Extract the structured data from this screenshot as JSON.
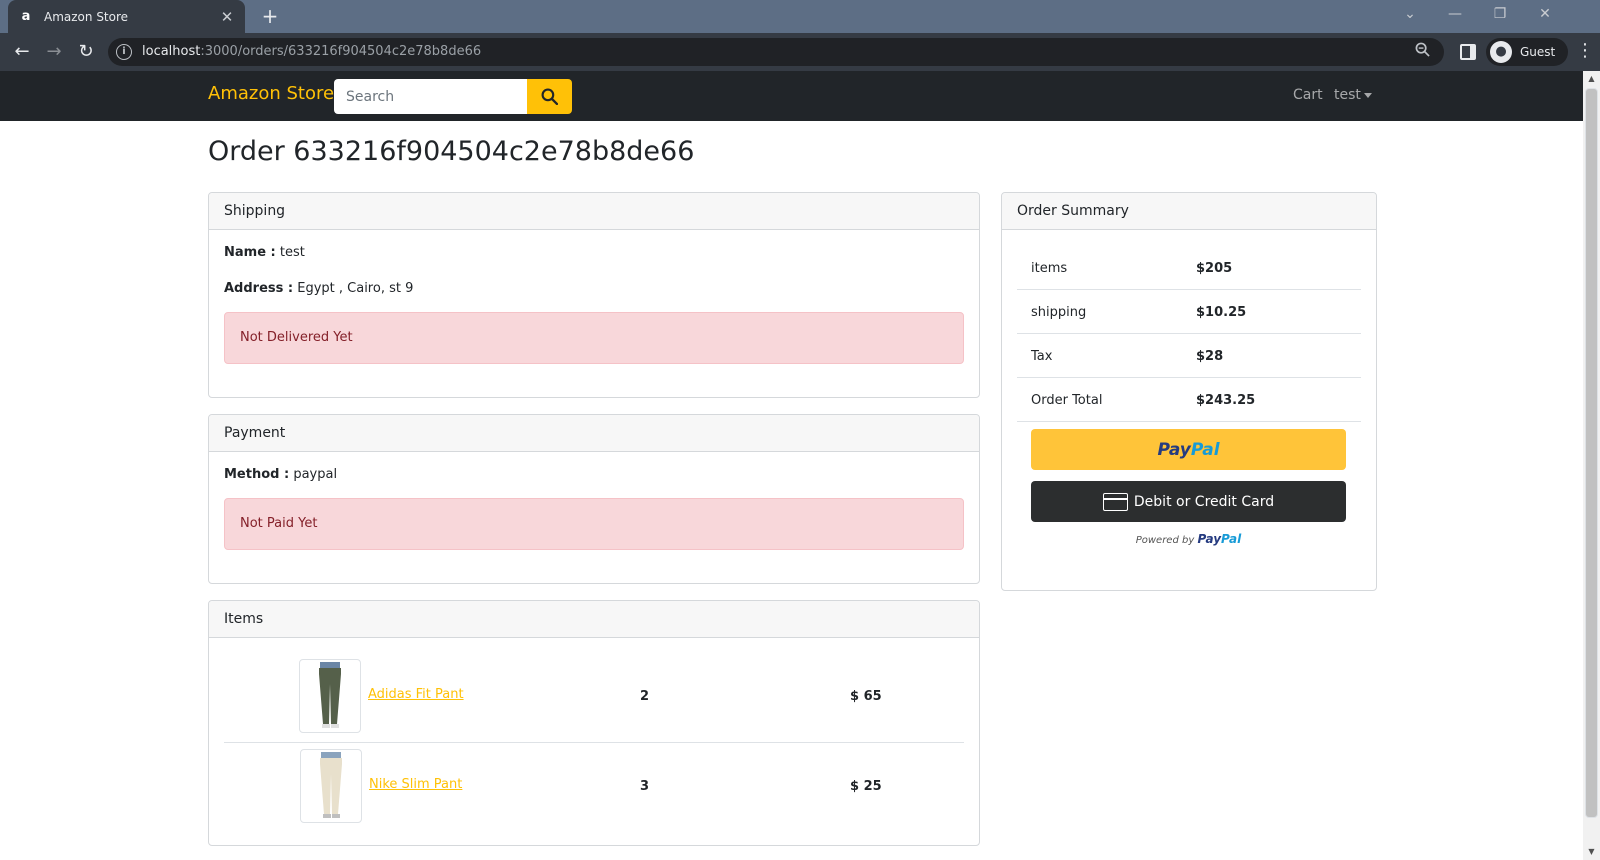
{
  "browser": {
    "tab_title": "Amazon Store",
    "favicon_glyph": "a",
    "url_host": "localhost",
    "url_rest": ":3000/orders/633216f904504c2e78b8de66",
    "profile_label": "Guest"
  },
  "navbar": {
    "brand": "Amazon Store",
    "search_placeholder": "Search",
    "cart_label": "Cart",
    "user_label": "test",
    "brand_color": "#ffc107"
  },
  "order": {
    "title": "Order 633216f904504c2e78b8de66"
  },
  "shipping": {
    "header": "Shipping",
    "name_label": "Name :",
    "name_value": "test",
    "address_label": "Address :",
    "address_value": "Egypt , Cairo, st 9",
    "status": "Not Delivered Yet"
  },
  "payment": {
    "header": "Payment",
    "method_label": "Method :",
    "method_value": "paypal",
    "status": "Not Paid Yet"
  },
  "items": {
    "header": "Items",
    "rows": [
      {
        "name": "Adidas Fit Pant",
        "qty": "2",
        "price": "$ 65",
        "image": "dark-pants"
      },
      {
        "name": "Nike Slim Pant",
        "qty": "3",
        "price": "$ 25",
        "image": "light-pants"
      }
    ]
  },
  "summary": {
    "header": "Order Summary",
    "rows": [
      {
        "label": "items",
        "value": "$205"
      },
      {
        "label": "shipping",
        "value": "$10.25"
      },
      {
        "label": "Tax",
        "value": "$28"
      },
      {
        "label": "Order Total",
        "value": "$243.25"
      }
    ],
    "paypal_pay": "Pay",
    "paypal_pal": "Pal",
    "card_button": "Debit or Credit Card",
    "powered_by": "Powered by",
    "powered_pay": "Pay",
    "powered_pal": "Pal",
    "paypal_dark_blue": "#253b80",
    "paypal_light_blue": "#179bd7"
  }
}
